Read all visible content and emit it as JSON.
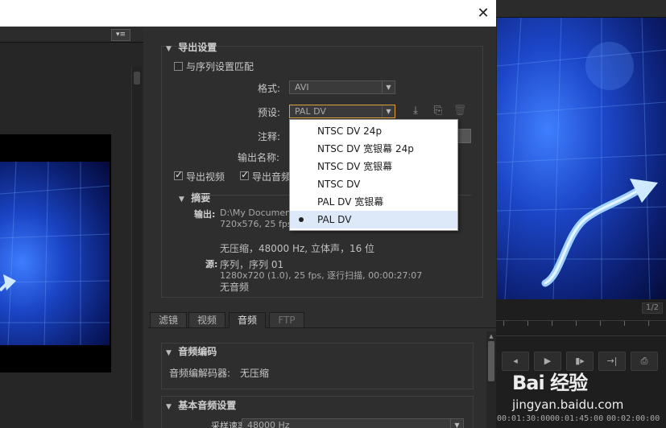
{
  "window": {
    "close_glyph": "✕"
  },
  "source_panel": {
    "menu_glyph": "▾≡"
  },
  "export_settings": {
    "header": "导出设置",
    "match_sequence_label": "与序列设置匹配",
    "format_label": "格式:",
    "format_value": "AVI",
    "preset_label": "预设:",
    "preset_value": "PAL DV",
    "comment_label": "注释:",
    "output_name_label": "输出名称:",
    "export_video_label": "导出视频",
    "export_audio_label": "导出音频"
  },
  "preset_dropdown": {
    "options": [
      {
        "label": "NTSC DV 24p",
        "selected": false
      },
      {
        "label": "NTSC DV 宽银幕 24p",
        "selected": false
      },
      {
        "label": "NTSC DV 宽银幕",
        "selected": false
      },
      {
        "label": "NTSC DV",
        "selected": false
      },
      {
        "label": "PAL DV 宽银幕",
        "selected": false
      },
      {
        "label": "PAL DV",
        "selected": true
      }
    ]
  },
  "summary": {
    "header": "摘要",
    "output_label": "输出:",
    "output_line1": "D:\\My Documents",
    "output_line2": "720x576, 25 fps,",
    "output_line3": "无压缩，48000 Hz, 立体声，16 位",
    "source_label": "源:",
    "source_line1": "序列，序列 01",
    "source_line2": "1280x720 (1.0), 25 fps, 逐行扫描, 00:00:27:07",
    "source_line3": "无音频"
  },
  "tabs": [
    {
      "label": "滤镜",
      "active": false
    },
    {
      "label": "视频",
      "active": false
    },
    {
      "label": "音频",
      "active": true
    },
    {
      "label": "FTP",
      "active": false
    }
  ],
  "audio_codec": {
    "header": "音频编码",
    "codec_label": "音频编解码器:",
    "codec_value": "无压缩"
  },
  "basic_audio": {
    "header": "基本音频设置",
    "sample_rate_label": "采样速率:",
    "sample_rate_value": "48000 Hz"
  },
  "program_monitor": {
    "page_indicator": "1/2",
    "timecodes": [
      "00:01:30:00",
      "00:01:45:00",
      "00:02:00:00"
    ]
  },
  "watermark": {
    "logo": "Bai 经验",
    "url": "jingyan.baidu.com"
  },
  "colors": {
    "accent_focus": "#e0a040",
    "dropdown_selected": "#dde9f8",
    "video_blue": "#1c46c8"
  }
}
